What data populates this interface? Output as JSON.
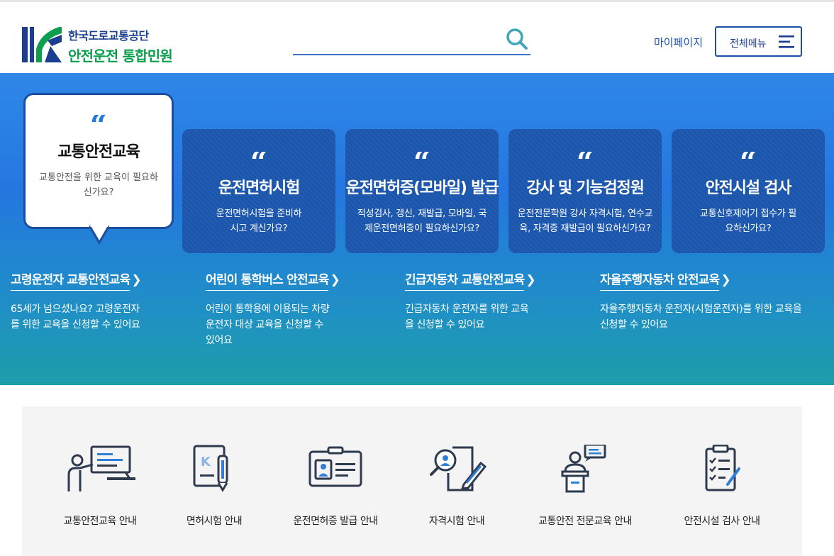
{
  "header": {
    "org_name": "한국도로교통공단",
    "service_name": "안전운전 통합민원",
    "search_placeholder": "",
    "mypage_label": "마이페이지",
    "menu_label": "전체메뉴"
  },
  "hero": {
    "bubble": {
      "title": "교통안전교육",
      "description": "교통안전을 위한 교육이 필요하신가요?"
    },
    "cards": [
      {
        "title": "운전면허시험",
        "description": "운전면허시험을 준비하시고 계신가요?"
      },
      {
        "title": "운전면허증(모바일) 발급",
        "description": "적성검사, 갱신, 재발급, 모바일, 국제운전면허증이 필요하신가요?"
      },
      {
        "title": "강사 및 기능검정원",
        "description": "운전전문학원 강사 자격시험, 연수교육, 자격증 재발급이 필요하신가요?"
      },
      {
        "title": "안전시설 검사",
        "description": "교통신호제어기 접수가 필요하신가요?"
      }
    ],
    "education_links": [
      {
        "title": "고령운전자 교통안전교육",
        "description": "65세가 넘으셨나요? 고령운전자를 위한 교육을 신청할 수 있어요"
      },
      {
        "title": "어린이 통학버스 안전교육",
        "description": "어린이 통학용에 이용되는 차량 운전자 대상 교육을 신청할 수 있어요"
      },
      {
        "title": "긴급자동차 교통안전교육",
        "description": "긴급자동차 운전자를 위한 교육을 신청할 수 있어요"
      },
      {
        "title": "자율주행자동차 안전교육",
        "description": "자율주행자동차 운전자(시험운전자)를 위한 교육을 신청할 수 있어요"
      }
    ]
  },
  "quick_menu": [
    {
      "label": "교통안전교육 안내",
      "icon": "teacher-board-icon"
    },
    {
      "label": "면허시험 안내",
      "icon": "license-pen-icon"
    },
    {
      "label": "운전면허증 발급 안내",
      "icon": "id-card-icon"
    },
    {
      "label": "자격시험 안내",
      "icon": "exam-search-icon"
    },
    {
      "label": "교통안전 전문교육 안내",
      "icon": "lecturer-podium-icon"
    },
    {
      "label": "안전시설 검사 안내",
      "icon": "checklist-clipboard-icon"
    }
  ],
  "colors": {
    "brand_blue": "#1b4fa8",
    "brand_green": "#0d9e4d",
    "hero_top": "#2f87e8",
    "hero_bottom": "#1e9ea8",
    "card_bg": "#1b56ad"
  }
}
